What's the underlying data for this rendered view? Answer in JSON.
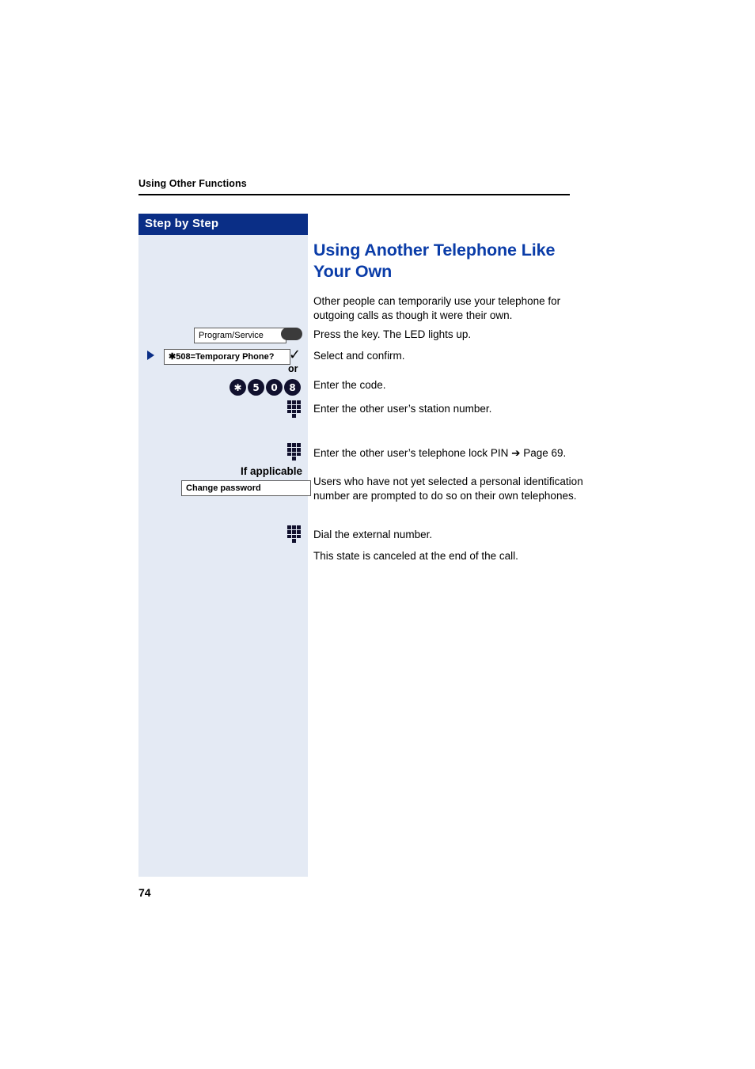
{
  "document": {
    "running_header": "Using Other Functions",
    "page_number": "74"
  },
  "sidebar": {
    "title": "Step by Step",
    "items": [
      {
        "type": "softkey-with-led",
        "label": "Program/Service",
        "icon": "led-indicator"
      },
      {
        "type": "menu-option",
        "label": "✱508=Temporary Phone?",
        "marker": "right-arrow-marker",
        "confirm_icon": "checkmark-icon",
        "or_label": "or"
      },
      {
        "type": "keypad-code",
        "keys": [
          "✱",
          "5",
          "0",
          "8"
        ]
      },
      {
        "type": "dialpad",
        "icon": "dialpad-icon"
      },
      {
        "type": "dialpad",
        "icon": "dialpad-icon"
      },
      {
        "type": "note",
        "label": "If applicable"
      },
      {
        "type": "softkey",
        "label": "Change password"
      },
      {
        "type": "dialpad",
        "icon": "dialpad-icon"
      }
    ]
  },
  "main": {
    "title": "Using Another Telephone Like Your Own",
    "paragraphs": [
      "Other people can temporarily use your telephone for outgoing calls as though it were their own.",
      "Press the key. The LED lights up.",
      "Select and confirm.",
      "Enter the code.",
      "Enter the other user’s station number.",
      "Enter the other user’s telephone lock PIN ➔ Page 69.",
      "Users who have not yet selected a personal identification number are prompted to do so on their own telephones.",
      "Dial the external number.",
      "This state is canceled at the end of the call."
    ]
  },
  "colors": {
    "accent_blue": "#0a3ca8",
    "sidebar_bar": "#0a2e86",
    "sidebar_bg": "#e4eaf4",
    "key_dark": "#11112e"
  }
}
